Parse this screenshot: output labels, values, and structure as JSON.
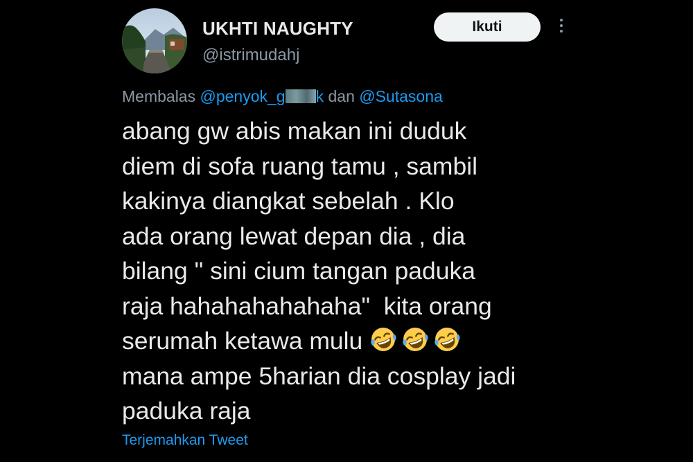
{
  "author": {
    "display_name": "UKHTI NAUGHTY",
    "handle": "@istrimudahj"
  },
  "header": {
    "follow_label": "Ikuti",
    "more_icon": "more-vertical-icon"
  },
  "reply": {
    "prefix": "Membalas",
    "mention_1_prefix": "@penyok_g",
    "mention_1_suffix": "k",
    "conjunction": "dan",
    "mention_2": "@Sutasona"
  },
  "tweet": {
    "lines": [
      "abang gw abis makan ini duduk",
      "diem di sofa ruang tamu , sambil",
      "kakinya diangkat sebelah . Klo",
      "ada orang lewat depan dia , dia",
      "bilang \" sini cium tangan paduka",
      "raja hahahahahahaha\"  kita orang",
      "serumah ketawa mulu ",
      "mana ampe 5harian dia cosplay jadi",
      "paduka raja"
    ],
    "emoji_icon": "rolling-on-floor-laughing-emoji-icon",
    "emoji_count": 3
  },
  "translate_label": "Terjemahkan Tweet",
  "colors": {
    "background": "#000000",
    "text": "#e7e9ea",
    "secondary": "#8b98a5",
    "link": "#1d9bf0",
    "button_bg": "#eff3f4"
  }
}
